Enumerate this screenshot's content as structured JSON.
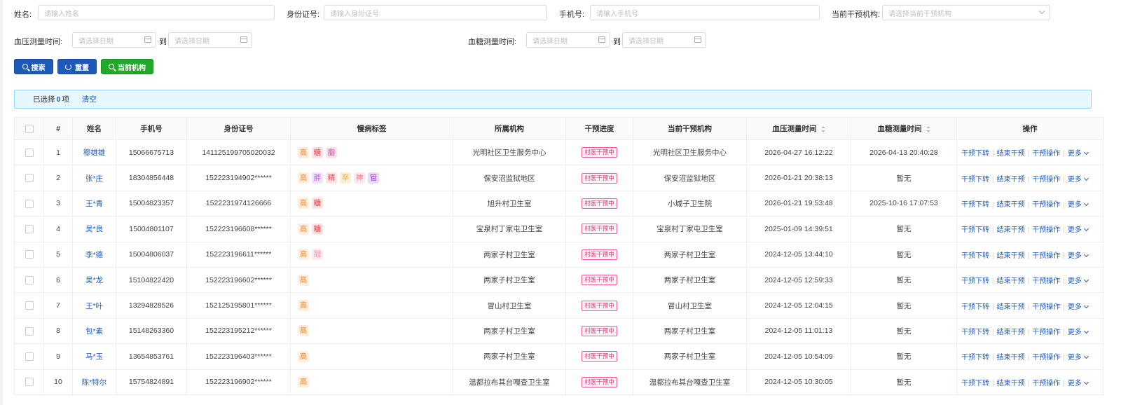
{
  "filters": {
    "name_label": "姓名:",
    "name_placeholder": "请输入姓名",
    "id_label": "身份证号:",
    "id_placeholder": "请输入身份证号",
    "phone_label": "手机号:",
    "phone_placeholder": "请输入手机号",
    "org_label": "当前干预机构:",
    "org_placeholder": "请选择当前干预机构",
    "bp_time_label": "血压测量时间:",
    "bs_time_label": "血糖测量时间:",
    "date_placeholder": "请选择日期",
    "to": "到"
  },
  "buttons": {
    "search": "搜索",
    "reset": "重置",
    "current_org": "当前机构"
  },
  "selection": {
    "prefix": "已选择",
    "count": "0",
    "suffix": "项",
    "clear": "清空"
  },
  "table": {
    "headers": {
      "index": "#",
      "name": "姓名",
      "phone": "手机号",
      "id": "身份证号",
      "tags": "慢病标签",
      "org": "所属机构",
      "progress": "干预进度",
      "cur_org": "当前干预机构",
      "bp_time": "血压测量时间",
      "bs_time": "血糖测量时间",
      "ops": "操作"
    },
    "ops": {
      "transfer": "干预下转",
      "end": "结束干预",
      "operate": "干预操作",
      "more": "更多"
    },
    "rows": [
      {
        "idx": "1",
        "name": "穆雄雄",
        "phone": "15066675713",
        "id": "141125199705020032",
        "tags": [
          {
            "t": "高",
            "c": "t-gao"
          },
          {
            "t": "糖",
            "c": "t-tang"
          },
          {
            "t": "脂",
            "c": "t-zhi"
          }
        ],
        "org": "光明社区卫生服务中心",
        "progress": "村医干预中",
        "cur_org": "光明社区卫生服务中心",
        "bp": "2026-04-27 16:12:22",
        "bs": "2026-04-13 20:40:28"
      },
      {
        "idx": "2",
        "name": "张*庄",
        "phone": "18304856448",
        "id": "152223194902******",
        "tags": [
          {
            "t": "高",
            "c": "t-gao"
          },
          {
            "t": "胖",
            "c": "t-pang"
          },
          {
            "t": "精",
            "c": "t-jing"
          },
          {
            "t": "卒",
            "c": "t-zu"
          },
          {
            "t": "神",
            "c": "t-shen"
          },
          {
            "t": "管",
            "c": "t-guan"
          }
        ],
        "org": "保安沼监狱地区",
        "progress": "村医干预中",
        "cur_org": "保安沼监狱地区",
        "bp": "2026-01-21 20:38:13",
        "bs": "暂无"
      },
      {
        "idx": "3",
        "name": "王*青",
        "phone": "15004823357",
        "id": "1522231974126666",
        "tags": [
          {
            "t": "高",
            "c": "t-gao"
          },
          {
            "t": "糖",
            "c": "t-tang"
          }
        ],
        "org": "旭升村卫生室",
        "progress": "村医干预中",
        "cur_org": "小城子卫生院",
        "bp": "2026-01-21 19:53:48",
        "bs": "2025-10-16 17:07:53"
      },
      {
        "idx": "4",
        "name": "吴*良",
        "phone": "15004801107",
        "id": "152223196608******",
        "tags": [
          {
            "t": "高",
            "c": "t-gao"
          },
          {
            "t": "糖",
            "c": "t-tang"
          }
        ],
        "org": "宝泉村丁家屯卫生室",
        "progress": "村医干预中",
        "cur_org": "宝泉村丁家屯卫生室",
        "bp": "2025-01-09 14:39:51",
        "bs": "暂无"
      },
      {
        "idx": "5",
        "name": "李*德",
        "phone": "15004806037",
        "id": "152223196611******",
        "tags": [
          {
            "t": "高",
            "c": "t-gao"
          },
          {
            "t": "冠",
            "c": "t-guanx"
          }
        ],
        "org": "两家子村卫生室",
        "progress": "村医干预中",
        "cur_org": "两家子村卫生室",
        "bp": "2024-12-05 13:44:10",
        "bs": "暂无"
      },
      {
        "idx": "6",
        "name": "吴*龙",
        "phone": "15104822420",
        "id": "152223196602******",
        "tags": [
          {
            "t": "高",
            "c": "t-gao"
          }
        ],
        "org": "两家子村卫生室",
        "progress": "村医干预中",
        "cur_org": "两家子村卫生室",
        "bp": "2024-12-05 12:59:33",
        "bs": "暂无"
      },
      {
        "idx": "7",
        "name": "王*叶",
        "phone": "13294828526",
        "id": "152125195801******",
        "tags": [
          {
            "t": "高",
            "c": "t-gao"
          }
        ],
        "org": "冒山村卫生室",
        "progress": "村医干预中",
        "cur_org": "冒山村卫生室",
        "bp": "2024-12-05 12:04:15",
        "bs": "暂无"
      },
      {
        "idx": "8",
        "name": "包*素",
        "phone": "15148263360",
        "id": "152223195212******",
        "tags": [
          {
            "t": "高",
            "c": "t-gao"
          }
        ],
        "org": "两家子村卫生室",
        "progress": "村医干预中",
        "cur_org": "两家子村卫生室",
        "bp": "2024-12-05 11:01:13",
        "bs": "暂无"
      },
      {
        "idx": "9",
        "name": "马*玉",
        "phone": "13654853761",
        "id": "152223196403******",
        "tags": [
          {
            "t": "高",
            "c": "t-gao"
          }
        ],
        "org": "两家子村卫生室",
        "progress": "村医干预中",
        "cur_org": "两家子村卫生室",
        "bp": "2024-12-05 10:54:09",
        "bs": "暂无"
      },
      {
        "idx": "10",
        "name": "陈*特尔",
        "phone": "15754824891",
        "id": "152223196902******",
        "tags": [
          {
            "t": "高",
            "c": "t-gao"
          }
        ],
        "org": "温都拉布其台嘎查卫生室",
        "progress": "村医干预中",
        "cur_org": "温都拉布其台嘎查卫生室",
        "bp": "2024-12-05 10:30:05",
        "bs": "暂无"
      }
    ]
  }
}
